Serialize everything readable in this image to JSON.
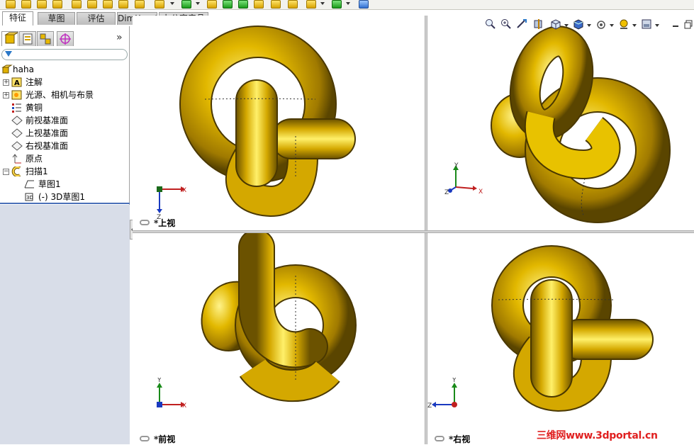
{
  "command_tabs": [
    "特征",
    "草图",
    "评估",
    "DimXpert",
    "办公室产品"
  ],
  "active_tab": "特征",
  "panel": {
    "expand_label": "»",
    "tree": {
      "root": "haha",
      "items": [
        {
          "label": "注解",
          "icon": "annotation-icon",
          "expandable": true
        },
        {
          "label": "光源、相机与布景",
          "icon": "lights-camera-icon",
          "expandable": true
        },
        {
          "label": "黄铜",
          "icon": "material-icon",
          "expandable": false
        },
        {
          "label": "前视基准面",
          "icon": "plane-icon",
          "expandable": false
        },
        {
          "label": "上视基准面",
          "icon": "plane-icon",
          "expandable": false
        },
        {
          "label": "右视基准面",
          "icon": "plane-icon",
          "expandable": false
        },
        {
          "label": "原点",
          "icon": "origin-icon",
          "expandable": false
        },
        {
          "label": "扫描1",
          "icon": "sweep-icon",
          "expandable": true,
          "expanded": true
        },
        {
          "label": "草图1",
          "icon": "sketch-icon",
          "child": true
        },
        {
          "label": "(-) 3D草图1",
          "icon": "3d-sketch-icon",
          "child": true
        }
      ]
    }
  },
  "viewports": {
    "top": {
      "label": "*上视",
      "axes": [
        "X",
        "Z"
      ]
    },
    "iso": {
      "label": "",
      "axes": [
        "Y",
        "X",
        "Z"
      ]
    },
    "front": {
      "label": "*前视",
      "axes": [
        "Y",
        "X"
      ]
    },
    "right": {
      "label": "*右视",
      "axes": [
        "Y",
        "Z"
      ]
    }
  },
  "hud_icons": [
    "zoom-to-fit-icon",
    "zoom-to-area-icon",
    "previous-view-icon",
    "section-view-icon",
    "view-orientation-icon",
    "display-style-icon",
    "hide-show-icon",
    "edit-appearance-icon",
    "apply-scene-icon",
    "view-settings-icon"
  ],
  "watermark": "三维网www.3dportal.cn",
  "colors": {
    "model": "#d4a800",
    "model_highlight": "#fff06a",
    "model_shadow": "#6b5200",
    "accent": "#4a70b8"
  }
}
